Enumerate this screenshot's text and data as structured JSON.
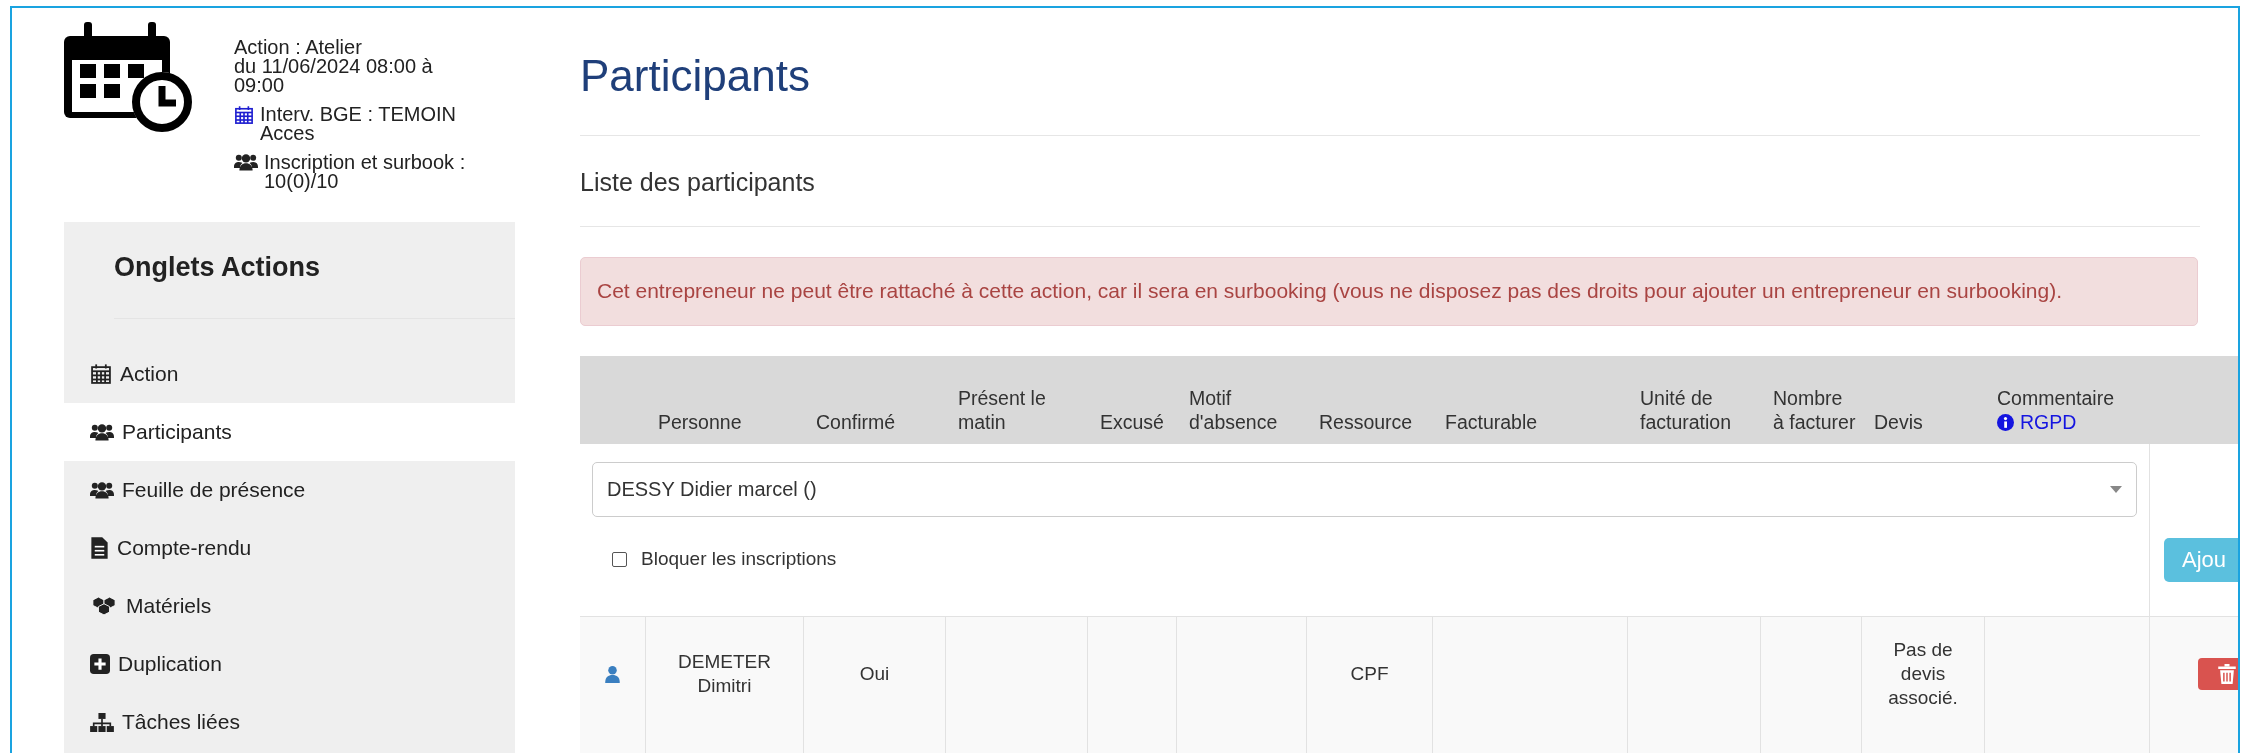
{
  "header": {
    "action_title": "Action : Atelier",
    "action_date": "du 11/06/2024 08:00 à 09:00",
    "intervenant": "Interv. BGE : TEMOIN Acces",
    "inscription": "Inscription et surbook : 10(0)/10"
  },
  "sidebar": {
    "title": "Onglets Actions",
    "items": [
      {
        "label": "Action",
        "selected": false
      },
      {
        "label": "Participants",
        "selected": true
      },
      {
        "label": "Feuille de présence",
        "selected": false
      },
      {
        "label": "Compte-rendu",
        "selected": false
      },
      {
        "label": "Matériels",
        "selected": false
      },
      {
        "label": "Duplication",
        "selected": false
      },
      {
        "label": "Tâches liées",
        "selected": false
      }
    ]
  },
  "page_title": "Participants",
  "section_title": "Liste des participants",
  "alert": "Cet entrepreneur ne peut être rattaché à cette action, car il sera en surbooking (vous ne disposez pas des droits pour ajouter un entrepreneur en surbooking).",
  "table": {
    "columns": [
      {
        "label": "Personne"
      },
      {
        "label": "Confirmé"
      },
      {
        "label": "Présent le matin"
      },
      {
        "label": "Excusé"
      },
      {
        "label": "Motif d'absence"
      },
      {
        "label": "Ressource"
      },
      {
        "label": "Facturable"
      },
      {
        "label": "Unité de facturation"
      },
      {
        "label": "Nombre à facturer"
      },
      {
        "label": "Devis"
      },
      {
        "label": "Commentaire",
        "link": "RGPD"
      }
    ],
    "add_form": {
      "person_select": "DESSY Didier marcel ()",
      "block_checkbox": {
        "label": "Bloquer les inscriptions",
        "checked": false
      },
      "add_button": "Ajou"
    },
    "rows": [
      {
        "personne": "DEMETER Dimitri",
        "confirme": "Oui",
        "ressource": "CPF",
        "devis": "Pas de devis associé."
      }
    ]
  }
}
